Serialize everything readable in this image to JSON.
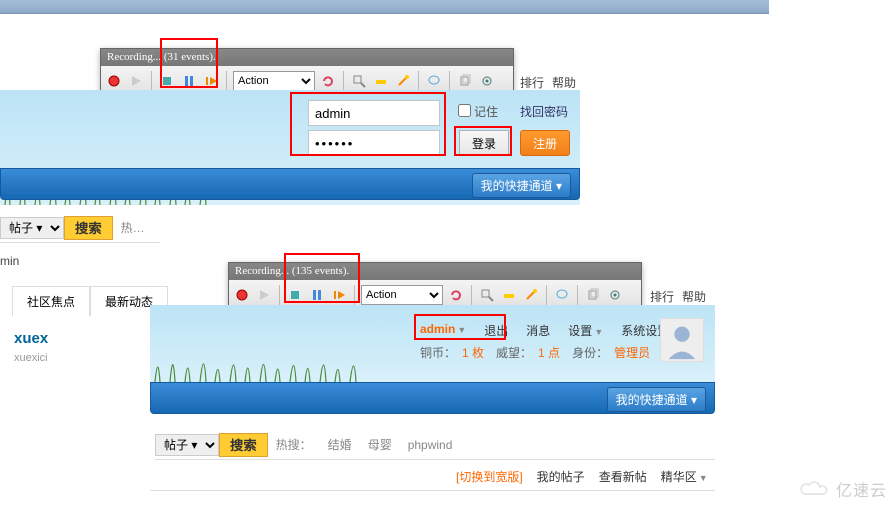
{
  "recorder1": {
    "title": "Recording... (31 events).",
    "action": "Action"
  },
  "recorder2": {
    "title": "Recording... (135 events).",
    "action": "Action"
  },
  "topnav": {
    "rank": "排行",
    "help": "帮助"
  },
  "login": {
    "username": "admin",
    "password": "••••••",
    "remember": "记住",
    "recover": "找回密码",
    "login_btn": "登录",
    "register_btn": "注册"
  },
  "quick": "我的快捷通道 ▾",
  "tabs": {
    "posts": "帖子 ▾",
    "search": "搜索",
    "hot_prefix": "热…",
    "hot_label": "热搜：",
    "hot1": "结婚",
    "hot2": "母婴",
    "hot3": "phpwind"
  },
  "comm": {
    "focus": "社区焦点",
    "latest": "最新动态"
  },
  "user": {
    "name": "xuex",
    "sub": "xuexici",
    "min": "min"
  },
  "logged": {
    "admin": "admin",
    "logout": "退出",
    "msg": "消息",
    "settings": "设置",
    "sys": "系统设置",
    "coin_l": "铜币：",
    "coin_v": "1 枚",
    "rep_l": "威望：",
    "rep_v": "1 点",
    "role_l": "身份：",
    "role_v": "管理员"
  },
  "footer": {
    "wide": "[切换到宽版]",
    "my": "我的帖子",
    "new": "查看新帖",
    "best": "精华区"
  },
  "wm": "亿速云"
}
